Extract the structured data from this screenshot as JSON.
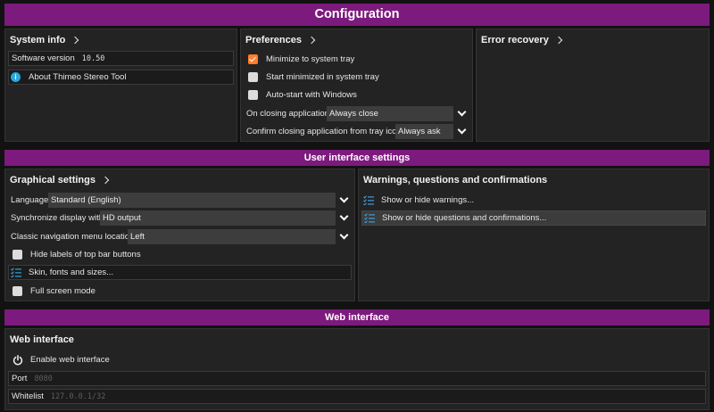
{
  "header": {
    "title": "Configuration"
  },
  "system_info": {
    "title": "System info",
    "version_label": "Software version",
    "version_value": "10.50",
    "about_label": "About Thimeo Stereo Tool"
  },
  "preferences": {
    "title": "Preferences",
    "minimize_tray": "Minimize to system tray",
    "start_minimized": "Start minimized in system tray",
    "autostart": "Auto-start with Windows",
    "on_closing_label": "On closing application",
    "on_closing_value": "Always close",
    "confirm_closing_label": "Confirm closing application from tray icon",
    "confirm_closing_value": "Always ask",
    "accent_color": "#ff7f2a"
  },
  "error_recovery": {
    "title": "Error recovery"
  },
  "ui_settings": {
    "banner": "User interface settings"
  },
  "graphical": {
    "title": "Graphical settings",
    "language_label": "Language",
    "language_value": "Standard (English)",
    "sync_label": "Synchronize display with",
    "sync_value": "HD output",
    "nav_label": "Classic navigation menu location",
    "nav_value": "Left",
    "hide_labels": "Hide labels of top bar buttons",
    "skin": "Skin, fonts and sizes...",
    "fullscreen": "Full screen mode"
  },
  "warnings": {
    "title": "Warnings, questions and confirmations",
    "show_warnings": "Show or hide warnings...",
    "show_questions": "Show or hide questions and confirmations..."
  },
  "web": {
    "banner": "Web interface",
    "title": "Web interface",
    "enable": "Enable web interface",
    "port_label": "Port",
    "port_value": "8080",
    "whitelist_label": "Whitelist",
    "whitelist_value": "127.0.0.1/32"
  },
  "colors": {
    "banner": "#7d1a7d",
    "info_icon": "#2aa8e0",
    "list_icon": "#3aa0e0"
  }
}
